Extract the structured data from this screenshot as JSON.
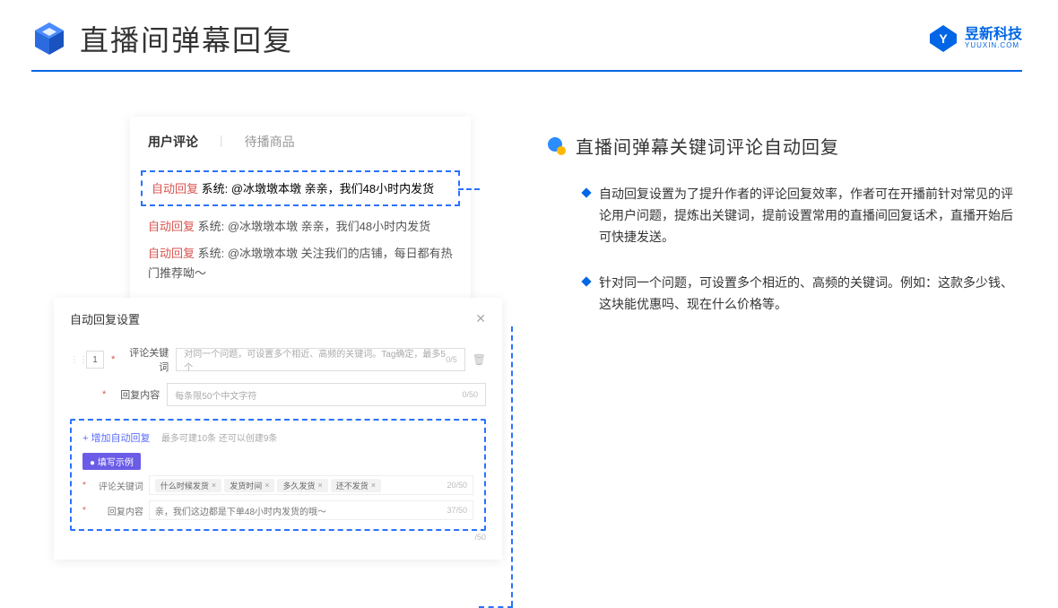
{
  "header": {
    "title": "直播间弹幕回复",
    "brand_name": "昱新科技",
    "brand_url": "YUUXIN.COM"
  },
  "comments_card": {
    "tab_active": "用户评论",
    "tab_inactive": "待播商品",
    "highlighted": {
      "tag": "自动回复",
      "text": " 系统: @冰墩墩本墩 亲亲，我们48小时内发货"
    },
    "lines": [
      {
        "tag": "自动回复",
        "text": " 系统: @冰墩墩本墩 亲亲，我们48小时内发货"
      },
      {
        "tag": "自动回复",
        "text": " 系统: @冰墩墩本墩 关注我们的店铺，每日都有热门推荐呦～"
      }
    ]
  },
  "dialog": {
    "title": "自动回复设置",
    "index": "1",
    "keyword_label": "评论关键词",
    "keyword_placeholder": "对同一个问题，可设置多个相近、高频的关键词。Tag确定，最多5个",
    "keyword_counter": "0/5",
    "content_label": "回复内容",
    "content_placeholder": "每条限50个中文字符",
    "content_counter": "0/50",
    "add_link": "+ 增加自动回复",
    "add_note": "最多可建10条 还可以创建9条",
    "example_badge": "● 填写示例",
    "ex_keyword_label": "评论关键词",
    "ex_tags": [
      "什么时候发货",
      "发货时间",
      "多久发货",
      "还不发货"
    ],
    "ex_keyword_counter": "20/50",
    "ex_content_label": "回复内容",
    "ex_content_value": "亲，我们这边都是下单48小时内发货的哦～",
    "ex_content_counter": "37/50",
    "extra_counter": "/50"
  },
  "right": {
    "section_title": "直播间弹幕关键词评论自动回复",
    "bullets": [
      "自动回复设置为了提升作者的评论回复效率，作者可在开播前针对常见的评论用户问题，提炼出关键词，提前设置常用的直播间回复话术，直播开始后可快捷发送。",
      "针对同一个问题，可设置多个相近的、高频的关键词。例如：这款多少钱、这块能优惠吗、现在什么价格等。"
    ]
  }
}
